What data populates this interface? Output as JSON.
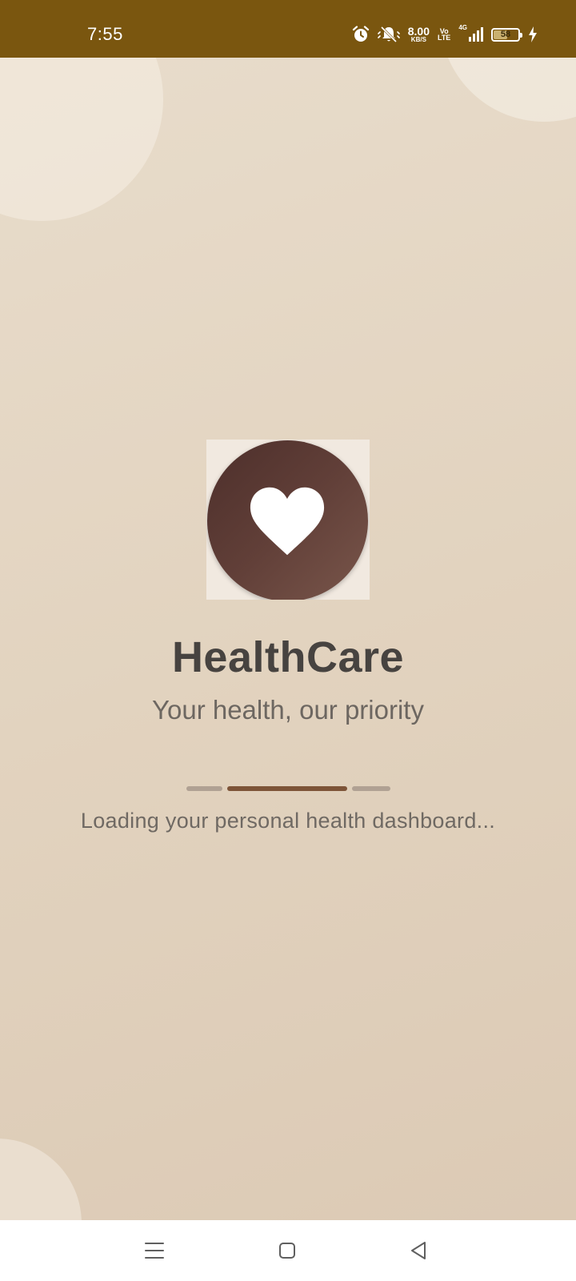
{
  "status_bar": {
    "time": "7:55",
    "net_speed_value": "8.00",
    "net_speed_unit": "KB/S",
    "volte_top": "Vo",
    "volte_bottom": "LTE",
    "network_type": "4G",
    "battery_percent": "58",
    "battery_level": 0.58,
    "icons": [
      "alarm-icon",
      "mute-icon",
      "signal-icon",
      "battery-icon",
      "charging-icon"
    ]
  },
  "splash": {
    "app_name": "HealthCare",
    "tagline": "Your health, our priority",
    "loading_message": "Loading your personal health dashboard...",
    "logo_icon": "heart-icon"
  },
  "nav_bar": {
    "icons": [
      "menu-icon",
      "home-icon",
      "back-icon"
    ]
  },
  "colors": {
    "status_bar_bg": "#7a560f",
    "background": "#e3d4c0",
    "logo_circle": "#5b3a33",
    "title_text": "#474340",
    "loader_active": "#7d5438",
    "loader_inactive": "#b0a193"
  }
}
